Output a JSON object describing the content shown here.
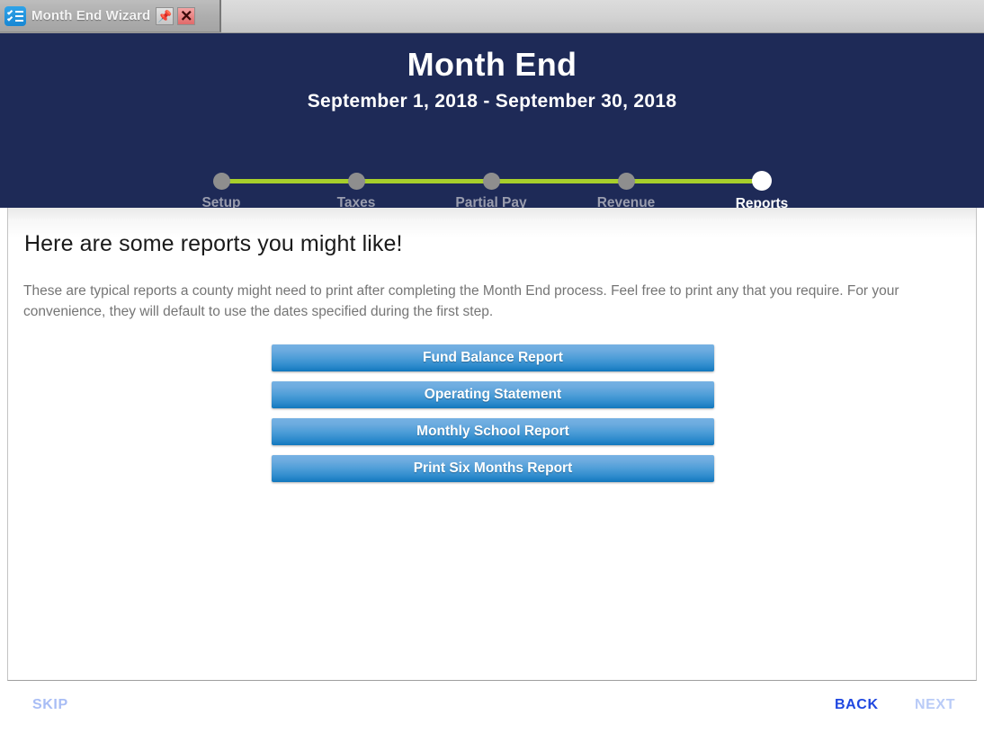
{
  "window": {
    "tab_title": "Month End Wizard",
    "app_icon": "checklist-icon",
    "pin_icon": "pushpin-icon",
    "close_icon": "close-x-icon"
  },
  "header": {
    "title": "Month End",
    "date_range": "September 1, 2018  -  September 30, 2018",
    "accent_line_color": "#a7cf2b",
    "background_color": "#1e2a57",
    "steps": [
      {
        "label": "Setup",
        "state": "complete"
      },
      {
        "label": "Taxes",
        "state": "complete"
      },
      {
        "label": "Partial Pay",
        "state": "complete"
      },
      {
        "label": "Revenue",
        "state": "complete"
      },
      {
        "label": "Reports",
        "state": "active"
      }
    ]
  },
  "main": {
    "heading": "Here are some reports you might like!",
    "paragraph": "These are typical reports a county might need to print after completing the Month End process.  Feel free to print any that you require.  For your convenience, they will default to use the dates specified during the first step.",
    "reports": [
      {
        "label": "Fund Balance Report"
      },
      {
        "label": "Operating Statement"
      },
      {
        "label": "Monthly School Report"
      },
      {
        "label": "Print Six Months Report"
      }
    ]
  },
  "footer": {
    "skip_label": "SKIP",
    "back_label": "BACK",
    "next_label": "NEXT",
    "skip_state": "disabled",
    "back_state": "enabled",
    "next_state": "disabled"
  }
}
